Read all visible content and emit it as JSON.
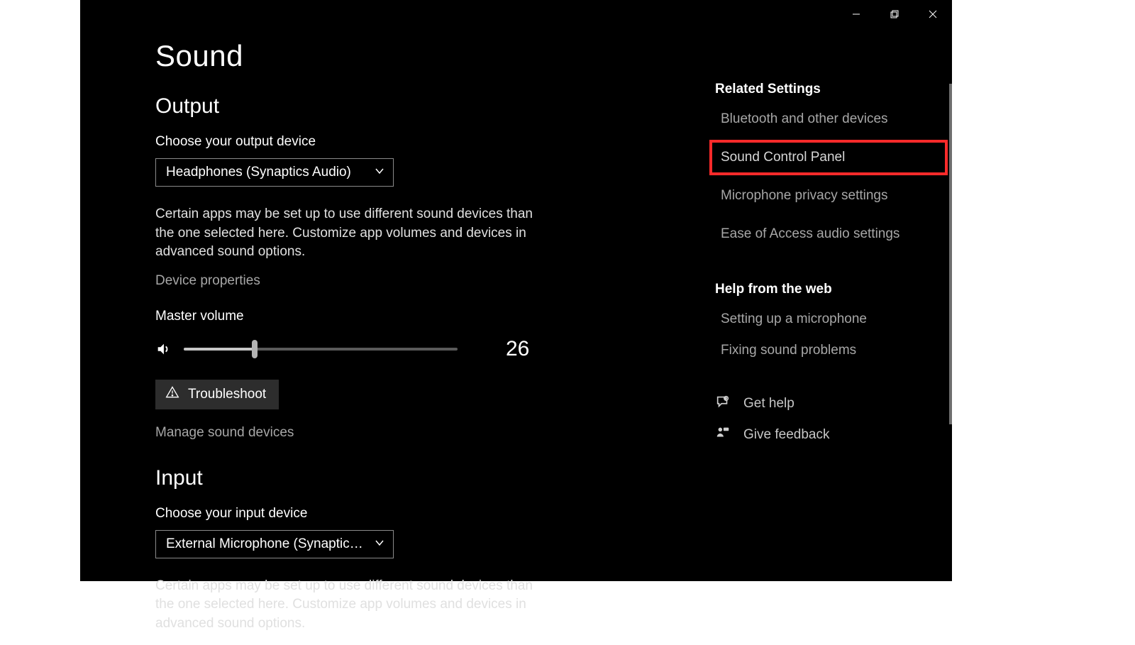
{
  "titlebar": {
    "minimize": "Minimize",
    "maximize": "Maximize",
    "close": "Close"
  },
  "page": {
    "title": "Sound"
  },
  "output": {
    "heading": "Output",
    "choose_label": "Choose your output device",
    "device": "Headphones (Synaptics Audio)",
    "description": "Certain apps may be set up to use different sound devices than the one selected here. Customize app volumes and devices in advanced sound options.",
    "device_properties": "Device properties",
    "master_volume_label": "Master volume",
    "volume_value": "26",
    "troubleshoot": "Troubleshoot",
    "manage_devices": "Manage sound devices"
  },
  "input": {
    "heading": "Input",
    "choose_label": "Choose your input device",
    "device": "External Microphone (Synaptics Aud...",
    "description": "Certain apps may be set up to use different sound devices than the one selected here. Customize app volumes and devices in advanced sound options."
  },
  "related": {
    "heading": "Related Settings",
    "bluetooth": "Bluetooth and other devices",
    "sound_control_panel": "Sound Control Panel",
    "mic_privacy": "Microphone privacy settings",
    "ease_of_access": "Ease of Access audio settings"
  },
  "help": {
    "heading": "Help from the web",
    "setting_up_mic": "Setting up a microphone",
    "fixing_sound": "Fixing sound problems",
    "get_help": "Get help",
    "give_feedback": "Give feedback"
  },
  "colors": {
    "highlight": "#ff2a2a"
  }
}
